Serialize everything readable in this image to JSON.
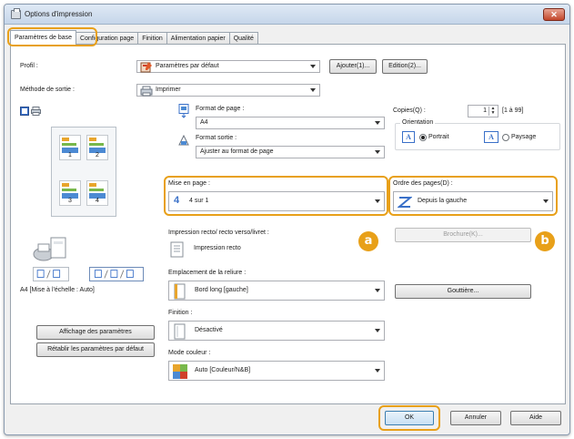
{
  "window": {
    "title": "Options d'impression",
    "close_glyph": "✕"
  },
  "tabs": [
    {
      "label": "Paramètres de base",
      "active": true
    },
    {
      "label": "Configuration page",
      "active": false
    },
    {
      "label": "Finition",
      "active": false
    },
    {
      "label": "Alimentation papier",
      "active": false
    },
    {
      "label": "Qualité",
      "active": false
    }
  ],
  "profile": {
    "label": "Profil :",
    "value": "Paramètres par défaut",
    "add_button": "Ajouter(1)...",
    "edit_button": "Edition(2)..."
  },
  "output_method": {
    "label": "Méthode de sortie :",
    "value": "Imprimer"
  },
  "preview": {
    "page_numbers": [
      "1",
      "2",
      "3",
      "4"
    ],
    "caption": "A4 [Mise à l'échelle : Auto]",
    "show_settings_button": "Affichage des paramètres",
    "restore_defaults_button": "Rétablir les paramètres par défaut"
  },
  "page_format": {
    "label": "Format de page :",
    "value": "A4"
  },
  "output_format": {
    "label": "Format sortie :",
    "value": "Ajuster au format de page"
  },
  "layout": {
    "label": "Mise en page :",
    "icon_number": "4",
    "value": "4 sur 1"
  },
  "duplex": {
    "label": "Impression recto/ recto verso/livret :",
    "value": "Impression recto"
  },
  "binding": {
    "label": "Emplacement de la reliure :",
    "value": "Bord long [gauche]"
  },
  "finishing": {
    "label": "Finition :",
    "value": "Désactivé"
  },
  "color_mode": {
    "label": "Mode couleur :",
    "value": "Auto [Couleur/N&B]"
  },
  "copies": {
    "label": "Copies(Q) :",
    "value": "1",
    "range": "[1 à 99]"
  },
  "orientation": {
    "group_label": "Orientation",
    "portrait": "Portrait",
    "landscape": "Paysage",
    "selected": "portrait",
    "icon_letter": "A"
  },
  "page_order": {
    "label": "Ordre des pages(D) :",
    "value": "Depuis la gauche"
  },
  "booklet_button": "Brochure(K)...",
  "gutter_button": "Gouttière...",
  "badges": {
    "a": "a",
    "b": "b"
  },
  "footer": {
    "ok": "OK",
    "cancel": "Annuler",
    "help": "Aide"
  },
  "colors": {
    "highlight": "#e8a019",
    "accent_blue": "#3a70c8"
  }
}
